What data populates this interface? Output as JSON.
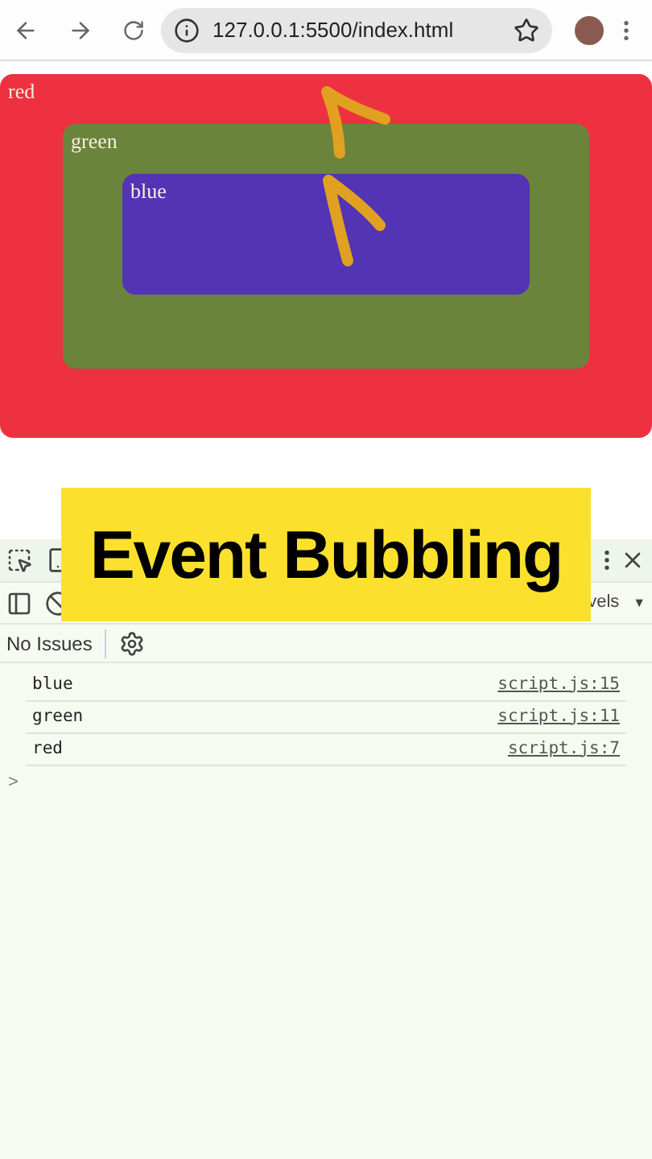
{
  "browser": {
    "url": "127.0.0.1:5500/index.html"
  },
  "page": {
    "box": {
      "label": "red",
      "color": "#ee3140",
      "children": [
        {
          "label": "green",
          "color": "#6b843b",
          "children": [
            {
              "label": "blue",
              "color": "#5234b4"
            }
          ]
        }
      ]
    }
  },
  "devtools": {
    "levels": "vels",
    "levels_caret": "▼",
    "issues": "No Issues",
    "logs": [
      {
        "message": "blue",
        "source": "script.js:15"
      },
      {
        "message": "green",
        "source": "script.js:11"
      },
      {
        "message": "red",
        "source": "script.js:7"
      }
    ],
    "prompt": ">"
  },
  "banner": {
    "title": "Event Bubbling"
  }
}
